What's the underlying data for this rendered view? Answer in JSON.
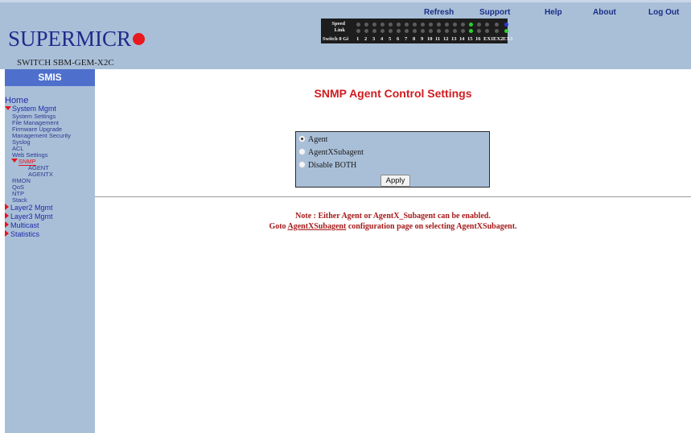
{
  "header": {
    "logo_text": "SUPERMICR",
    "model": "SWITCH SBM-GEM-X2C",
    "nav": [
      "Refresh",
      "Support",
      "Help",
      "About",
      "Log Out"
    ],
    "port_panel": {
      "speed_label": "Speed",
      "link_label": "Link",
      "switch_label": "Switch 0 Gi",
      "port_numbers": [
        "1",
        "2",
        "3",
        "4",
        "5",
        "6",
        "7",
        "8",
        "9",
        "10",
        "11",
        "12",
        "13",
        "14",
        "15",
        "16",
        "EX1",
        "EX2",
        "EX3"
      ],
      "speed_leds": [
        "off",
        "off",
        "off",
        "off",
        "off",
        "off",
        "off",
        "off",
        "off",
        "off",
        "off",
        "off",
        "off",
        "off",
        "green",
        "off",
        "off",
        "off",
        "blue"
      ],
      "link_leds": [
        "off",
        "off",
        "off",
        "off",
        "off",
        "off",
        "off",
        "off",
        "off",
        "off",
        "off",
        "off",
        "off",
        "off",
        "green",
        "off",
        "off",
        "off",
        "green"
      ]
    }
  },
  "sidebar": {
    "header": "SMIS",
    "home": "Home",
    "system_mgmt": {
      "label": "System Mgmt",
      "items": [
        "System Settings",
        "File Management",
        "Firmware Upgrade",
        "Management Security",
        "Syslog",
        "ACL",
        "Web Settings"
      ],
      "snmp": {
        "label": "SNMP",
        "children": [
          "AGENT",
          "AGENTX"
        ]
      },
      "items_after": [
        "RMON",
        "QoS",
        "NTP",
        "Stack"
      ]
    },
    "sections": [
      "Layer2 Mgmt",
      "Layer3 Mgmt",
      "Multicast",
      "Statistics"
    ]
  },
  "main": {
    "title": "SNMP Agent Control Settings",
    "options": [
      {
        "label": "Agent",
        "checked": true
      },
      {
        "label": "AgentXSubagent",
        "checked": false
      },
      {
        "label": "Disable BOTH",
        "checked": false
      }
    ],
    "apply_label": "Apply",
    "note_line1": "Note : Either Agent or AgentX_Subagent can be enabled.",
    "note_line2_prefix": "Goto ",
    "note_line2_link": "AgentXSubagent",
    "note_line2_suffix": " configuration page on selecting AgentXSubagent."
  },
  "colors": {
    "header_bg": "#a9bfd8",
    "sidebar_header_bg": "#4f6fcc",
    "title_red": "#d01c1f",
    "note_red": "#a51a1a",
    "logo_blue": "#1f2a8a",
    "logo_dot": "#e8181f"
  }
}
